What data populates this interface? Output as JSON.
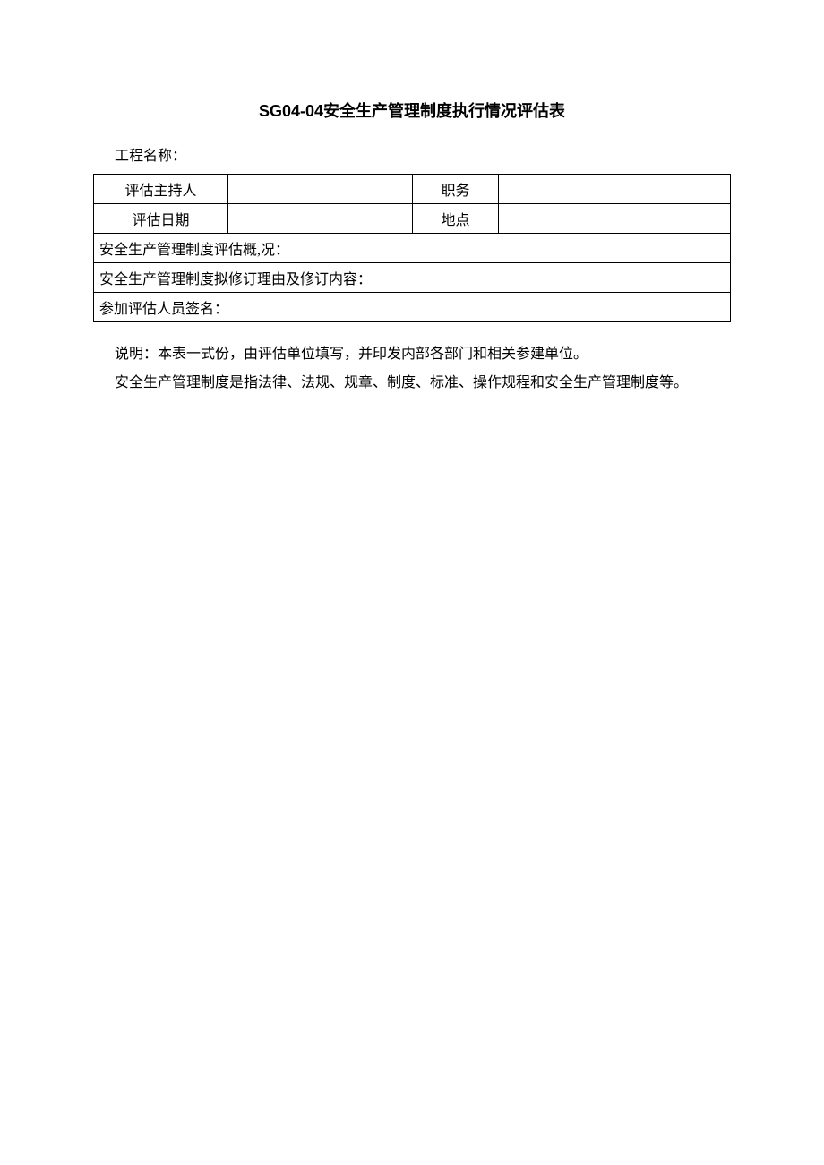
{
  "title_code": "SG04-04",
  "title_text": "安全生产管理制度执行情况评估表",
  "project_label": "工程名称：",
  "header": {
    "row1": {
      "label1": "评估主持人",
      "value1": "",
      "label2": "职务",
      "value2": ""
    },
    "row2": {
      "label1": "评估日期",
      "value1": "",
      "label2": "地点",
      "value2": ""
    }
  },
  "sections": {
    "s1_label": "安全生产管理制度评估概,况：",
    "s2_label": "安全生产管理制度拟修订理由及修订内容：",
    "s3_label": "参加评估人员签名："
  },
  "notes": {
    "line1": "说明：本表一式份，由评估单位填写，并印发内部各部门和相关参建单位。",
    "line2": "安全生产管理制度是指法律、法规、规章、制度、标准、操作规程和安全生产管理制度等。"
  }
}
